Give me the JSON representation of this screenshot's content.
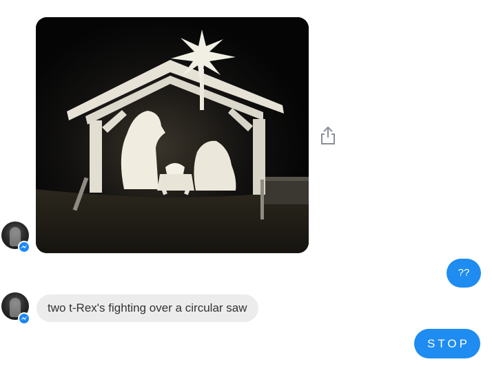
{
  "messages": {
    "incoming_text": "two t-Rex's fighting over a circular saw",
    "outgoing_question": "??",
    "outgoing_stop": "STOP"
  },
  "icons": {
    "share": "share-icon",
    "messenger_badge": "messenger-badge-icon"
  },
  "colors": {
    "outgoing_bubble": "#1e8cf0",
    "incoming_bubble": "#ececec",
    "badge": "#1e88f5"
  }
}
